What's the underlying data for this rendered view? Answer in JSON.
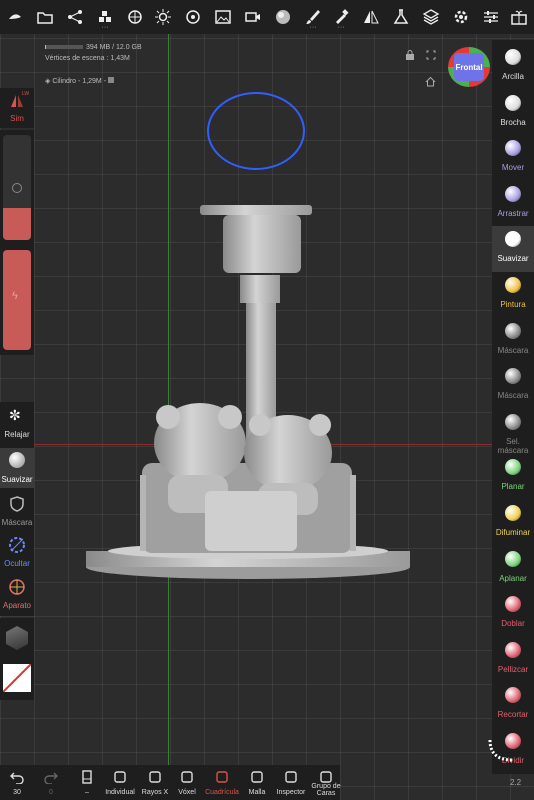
{
  "info": {
    "memory": "394 MB / 12.0 GB",
    "memory_fraction": 0.033,
    "vertices": "Vértices de escena : 1,43M",
    "object": "Cilindro - 1,29M -"
  },
  "view_gizmo": {
    "label": "Frontal"
  },
  "left_panel": {
    "sym_label": "Sim",
    "sym_badge": "LW",
    "tools": [
      {
        "label": "Relajar",
        "icon": "flower-icon"
      },
      {
        "label": "Suavizar",
        "icon": "smooth-sphere-icon"
      },
      {
        "label": "Máscara",
        "icon": "mask-shield-icon"
      },
      {
        "label": "Ocultar",
        "icon": "hide-icon"
      },
      {
        "label": "Aparato",
        "icon": "gizmo-icon"
      }
    ]
  },
  "right_tools": [
    {
      "label": "Arcilla",
      "color": "#dddddd"
    },
    {
      "label": "Brocha",
      "color": "#dddddd"
    },
    {
      "label": "Mover",
      "color": "#a7a0e0"
    },
    {
      "label": "Arrastrar",
      "color": "#a7a0e0"
    },
    {
      "label": "Suavizar",
      "color": "#ffffff"
    },
    {
      "label": "Pintura",
      "color": "#f0c040"
    },
    {
      "label": "Máscara",
      "color": "#888888"
    },
    {
      "label": "Máscara",
      "color": "#888888"
    },
    {
      "label": "Sel. máscara",
      "color": "#888888"
    },
    {
      "label": "Planar",
      "color": "#7cd37c"
    },
    {
      "label": "Difuminar",
      "color": "#f0d050"
    },
    {
      "label": "Aplanar",
      "color": "#7cd37c"
    },
    {
      "label": "Doblar",
      "color": "#e06070"
    },
    {
      "label": "Pellizcar",
      "color": "#e06070"
    },
    {
      "label": "Recortar",
      "color": "#e06070"
    },
    {
      "label": "Dividir",
      "color": "#e06070"
    }
  ],
  "bottom": {
    "undo_count": "30",
    "redo_count": "0",
    "items": [
      "Individual",
      "Rayos X",
      "Vóxel",
      "Cuadrícula",
      "Malla",
      "Inspector",
      "Grupo de Caras"
    ],
    "active_item": "Cuadrícula",
    "active_color": "#d9534f"
  },
  "version": "2.2"
}
